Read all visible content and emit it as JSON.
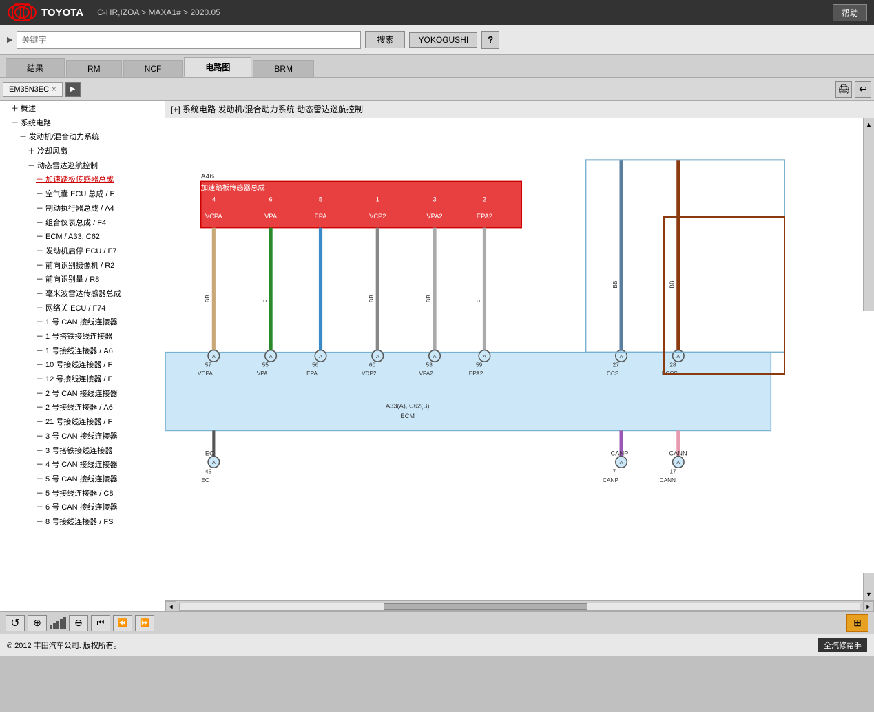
{
  "header": {
    "brand": "TOYOTA",
    "path": "C-HR,IZOA > MAXA1# > 2020.05",
    "help_label": "帮助"
  },
  "search": {
    "placeholder": "关键字",
    "search_label": "搜索",
    "yoko_label": "YOKOGUSHI"
  },
  "tabs": [
    {
      "label": "结果",
      "active": false
    },
    {
      "label": "RM",
      "active": false
    },
    {
      "label": "NCF",
      "active": false
    },
    {
      "label": "电路图",
      "active": true
    },
    {
      "label": "BRM",
      "active": false
    }
  ],
  "doc_tab": {
    "id": "EM35N3EC",
    "close_icon": "×",
    "play_icon": "▶"
  },
  "diagram_title": "[+] 系统电路   发动机/混合动力系统   动态雷达巡航控制",
  "sidebar": {
    "items": [
      {
        "label": "＋ 概述",
        "indent": 1,
        "type": "expandable"
      },
      {
        "label": "－ 系统电路",
        "indent": 1,
        "type": "expandable"
      },
      {
        "label": "－ 发动机/混合动力系统",
        "indent": 2,
        "type": "expandable"
      },
      {
        "label": "＋ 冷却风扇",
        "indent": 3,
        "type": "expandable"
      },
      {
        "label": "－ 动态雷达巡航控制",
        "indent": 3,
        "type": "expandable"
      },
      {
        "label": "－ 加速踏板传感器总成",
        "indent": 4,
        "type": "item",
        "selected": true
      },
      {
        "label": "－ 空气囊 ECU 总成 / F",
        "indent": 4,
        "type": "item"
      },
      {
        "label": "－ 制动执行器总成 / A4",
        "indent": 4,
        "type": "item"
      },
      {
        "label": "－ 组合仪表总成 / F4",
        "indent": 4,
        "type": "item"
      },
      {
        "label": "－ ECM / A33, C62",
        "indent": 4,
        "type": "item"
      },
      {
        "label": "－ 发动机启停 ECU / F7",
        "indent": 4,
        "type": "item"
      },
      {
        "label": "－ 前向识别摄像机 / R2",
        "indent": 4,
        "type": "item"
      },
      {
        "label": "－ 前向识别量 / R8",
        "indent": 4,
        "type": "item"
      },
      {
        "label": "－ 毫米波雷达传感器总成",
        "indent": 4,
        "type": "item"
      },
      {
        "label": "－ 网络关 ECU / F74",
        "indent": 4,
        "type": "item"
      },
      {
        "label": "－ 1 号 CAN 接线连接器",
        "indent": 4,
        "type": "item"
      },
      {
        "label": "－ 1 号搭铁接线连接器",
        "indent": 4,
        "type": "item"
      },
      {
        "label": "－ 1 号接线连接器 / A6",
        "indent": 4,
        "type": "item"
      },
      {
        "label": "－ 10 号接线连接器 / F",
        "indent": 4,
        "type": "item"
      },
      {
        "label": "－ 12 号接线连接器 / F",
        "indent": 4,
        "type": "item"
      },
      {
        "label": "－ 2 号 CAN 接线连接器",
        "indent": 4,
        "type": "item"
      },
      {
        "label": "－ 2 号接线连接器 / A6",
        "indent": 4,
        "type": "item"
      },
      {
        "label": "－ 21 号接线连接器 / F",
        "indent": 4,
        "type": "item"
      },
      {
        "label": "－ 3 号 CAN 接线连接器",
        "indent": 4,
        "type": "item"
      },
      {
        "label": "－ 3 号搭铁接线连接器",
        "indent": 4,
        "type": "item"
      },
      {
        "label": "－ 4 号 CAN 接线连接器",
        "indent": 4,
        "type": "item"
      },
      {
        "label": "－ 5 号 CAN 接线连接器",
        "indent": 4,
        "type": "item"
      },
      {
        "label": "－ 5 号接线连接器 / C8",
        "indent": 4,
        "type": "item"
      },
      {
        "label": "－ 6 号 CAN 接线连接器",
        "indent": 4,
        "type": "item"
      },
      {
        "label": "－ 8 号接线连接器 / FS",
        "indent": 4,
        "type": "item"
      }
    ]
  },
  "circuit": {
    "component_label": "加速踏板传感器总成",
    "component_ref": "A46",
    "pins": [
      {
        "name": "VCPA",
        "pin": "4",
        "wire_color": "tan",
        "connector_num": "57",
        "connector_type": "A"
      },
      {
        "name": "VPA",
        "pin": "6",
        "wire_color": "green",
        "connector_num": "55",
        "connector_type": "A"
      },
      {
        "name": "EPA",
        "pin": "5",
        "wire_color": "blue",
        "connector_num": "56",
        "connector_type": "A"
      },
      {
        "name": "VCP2",
        "pin": "1",
        "wire_color": "gray",
        "connector_num": "60",
        "connector_type": "A"
      },
      {
        "name": "VPA2",
        "pin": "3",
        "wire_color": "lightgray",
        "connector_num": "53",
        "connector_type": "A"
      },
      {
        "name": "EPA2",
        "pin": "2",
        "wire_color": "lightgray",
        "connector_num": "59",
        "connector_type": "A"
      }
    ],
    "ecm_label": "A33(A), C62(B)",
    "ecm_sublabel": "ECM",
    "ecm_pins": [
      {
        "name": "CCS",
        "pin": "27",
        "connector_type": "A",
        "wire_color": "#5B7F9E"
      },
      {
        "name": "ECCS",
        "pin": "28",
        "connector_type": "A",
        "wire_color": "#8B3A10"
      }
    ],
    "bottom_labels": [
      {
        "name": "EC",
        "pin": "45",
        "connector_type": "A"
      },
      {
        "name": "CANP",
        "pin": "7",
        "connector_type": "A"
      },
      {
        "name": "CANN",
        "pin": "17",
        "connector_type": "A"
      }
    ],
    "wire_labels": {
      "BB": "BB",
      "c": "c",
      "i": "i",
      "p": "p"
    }
  },
  "toolbar": {
    "refresh_icon": "↺",
    "zoom_in_icon": "⊕",
    "zoom_out_icon": "⊖",
    "prev_icon": "⏮",
    "next_icon": "⏭",
    "signal_bars": [
      1,
      2,
      3,
      4,
      5
    ],
    "screen_icon": "⊞"
  },
  "footer": {
    "copyright": "© 2012 丰田汽车公司. 版权所有。",
    "brand_logo": "全汽修帮手"
  },
  "scroll": {
    "left_arrow": "◄",
    "right_arrow": "►",
    "up_arrow": "▲",
    "down_arrow": "▼"
  }
}
